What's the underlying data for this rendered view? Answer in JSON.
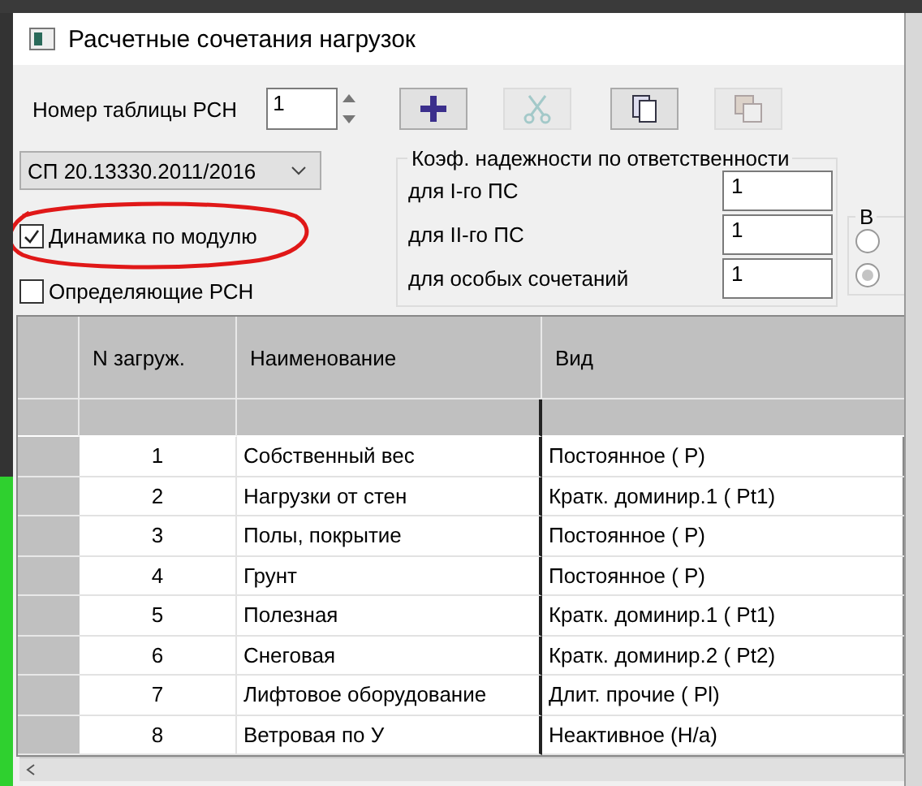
{
  "window": {
    "title": "Расчетные сочетания нагрузок"
  },
  "table_number": {
    "label": "Номер таблицы РСН",
    "value": "1"
  },
  "toolbar": [
    {
      "kind": "add",
      "disabled": false
    },
    {
      "kind": "cut",
      "disabled": true
    },
    {
      "kind": "copy",
      "disabled": false
    },
    {
      "kind": "paste",
      "disabled": true
    }
  ],
  "norm_select": {
    "value": "СП 20.13330.2011/2016"
  },
  "options": [
    {
      "label": "Динамика по модулю",
      "checked": true,
      "highlighted": true
    },
    {
      "label": "Определяющие РСН",
      "checked": false,
      "highlighted": false
    }
  ],
  "reliability": {
    "title": "Коэф. надежности по ответственности",
    "rows": [
      {
        "label": "для I-го ПС",
        "value": "1"
      },
      {
        "label": "для II-го ПС",
        "value": "1"
      },
      {
        "label": "для особых сочетаний",
        "value": "1"
      }
    ]
  },
  "side_group": {
    "title": "В",
    "radios": [
      {
        "selected": false
      },
      {
        "selected": true
      }
    ]
  },
  "table": {
    "columns": [
      "N загруж.",
      "Наименование",
      "Вид"
    ],
    "rows": [
      [
        "1",
        "Собственный вес",
        "Постоянное ( Р)"
      ],
      [
        "2",
        "Нагрузки от стен",
        "Кратк. доминир.1 ( Pt1)"
      ],
      [
        "3",
        "Полы, покрытие",
        "Постоянное ( Р)"
      ],
      [
        "4",
        "Грунт",
        "Постоянное ( Р)"
      ],
      [
        "5",
        "Полезная",
        "Кратк. доминир.1 ( Pt1)"
      ],
      [
        "6",
        "Снеговая",
        "Кратк. доминир.2 ( Pt2)"
      ],
      [
        "7",
        "Лифтовое оборудование",
        "Длит. прочие ( Pl)"
      ],
      [
        "8",
        "Ветровая по У",
        "Неактивное (Н/а)"
      ]
    ]
  }
}
